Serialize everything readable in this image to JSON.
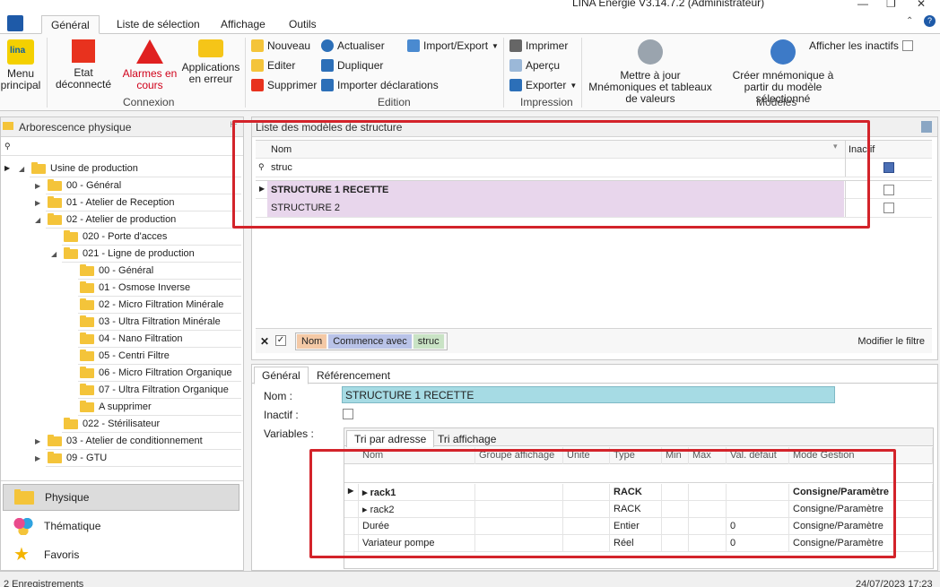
{
  "window": {
    "title": "LINA Energie  V3.14.7.2  (Administrateur)"
  },
  "ribbon_tabs": [
    "Général",
    "Liste de sélection",
    "Affichage",
    "Outils"
  ],
  "ribbon": {
    "menu_principal": "Menu principal",
    "etat": "Etat déconnecté",
    "alarmes": "Alarmes en cours",
    "applications": "Applications en erreur",
    "connexion_label": "Connexion",
    "nouveau": "Nouveau",
    "editer": "Editer",
    "supprimer": "Supprimer",
    "actualiser": "Actualiser",
    "dupliquer": "Dupliquer",
    "importer": "Importer déclarations",
    "import_export": "Import/Export",
    "edition_label": "Edition",
    "imprimer": "Imprimer",
    "apercu": "Aperçu",
    "exporter": "Exporter",
    "impression_label": "Impression",
    "maj": "Mettre à jour Mnémoniques et tableaux de valeurs",
    "creer": "Créer mnémonique à partir du modèle sélectionné",
    "afficher_inactifs": "Afficher les inactifs",
    "modeles_label": "Modèles"
  },
  "left": {
    "title": "Arborescence physique",
    "tree": [
      {
        "label": "Usine de production",
        "level": 0
      },
      {
        "label": "00 - Général",
        "level": 1
      },
      {
        "label": "01 - Atelier de Reception",
        "level": 1
      },
      {
        "label": "02 - Atelier de production",
        "level": 1
      },
      {
        "label": "020 - Porte d'acces",
        "level": 2
      },
      {
        "label": "021 - Ligne de production",
        "level": 2
      },
      {
        "label": "00 - Général",
        "level": 3
      },
      {
        "label": "01 - Osmose Inverse",
        "level": 3
      },
      {
        "label": "02 - Micro Filtration Minérale",
        "level": 3
      },
      {
        "label": "03 - Ultra Filtration Minérale",
        "level": 3
      },
      {
        "label": "04 - Nano Filtration",
        "level": 3
      },
      {
        "label": "05 - Centri Filtre",
        "level": 3
      },
      {
        "label": "06 - Micro Filtration Organique",
        "level": 3
      },
      {
        "label": "07 - Ultra Filtration Organique",
        "level": 3
      },
      {
        "label": "A supprimer",
        "level": 3
      },
      {
        "label": "022 - Stérilisateur",
        "level": 2
      },
      {
        "label": "03 - Atelier de conditionnement",
        "level": 1
      },
      {
        "label": "09 - GTU",
        "level": 1
      }
    ],
    "nav": [
      "Physique",
      "Thématique",
      "Favoris"
    ]
  },
  "structures": {
    "title": "Liste des modèles de structure",
    "col_nom": "Nom",
    "col_inactif": "Inactif",
    "filter_value": "struc",
    "rows": [
      "STRUCTURE 1 RECETTE",
      "STRUCTURE 2"
    ],
    "filter_pills": [
      "Nom",
      "Commence avec",
      "struc"
    ],
    "modifier_filtre": "Modifier le filtre"
  },
  "detail": {
    "tabs": [
      "Général",
      "Référencement"
    ],
    "nom_label": "Nom :",
    "nom_value": "STRUCTURE 1 RECETTE",
    "inactif_label": "Inactif :",
    "variables_label": "Variables :",
    "subtabs": [
      "Tri par adresse",
      "Tri affichage"
    ],
    "columns": [
      "Nom",
      "Groupe affichage",
      "Unite",
      "Type",
      "Min",
      "Max",
      "Val. défaut",
      "Mode Gestion"
    ],
    "rows": [
      {
        "nom": "rack1",
        "type": "RACK",
        "val": "",
        "mode": "Consigne/Paramètre",
        "bold": true
      },
      {
        "nom": "rack2",
        "type": "RACK",
        "val": "",
        "mode": "Consigne/Paramètre",
        "bold": false
      },
      {
        "nom": "Durée",
        "type": "Entier",
        "val": "0",
        "mode": "Consigne/Paramètre",
        "bold": false
      },
      {
        "nom": "Variateur pompe",
        "type": "Réel",
        "val": "0",
        "mode": "Consigne/Paramètre",
        "bold": false
      }
    ]
  },
  "status": {
    "left": "2 Enregistrements",
    "right": "24/07/2023 17:23"
  }
}
